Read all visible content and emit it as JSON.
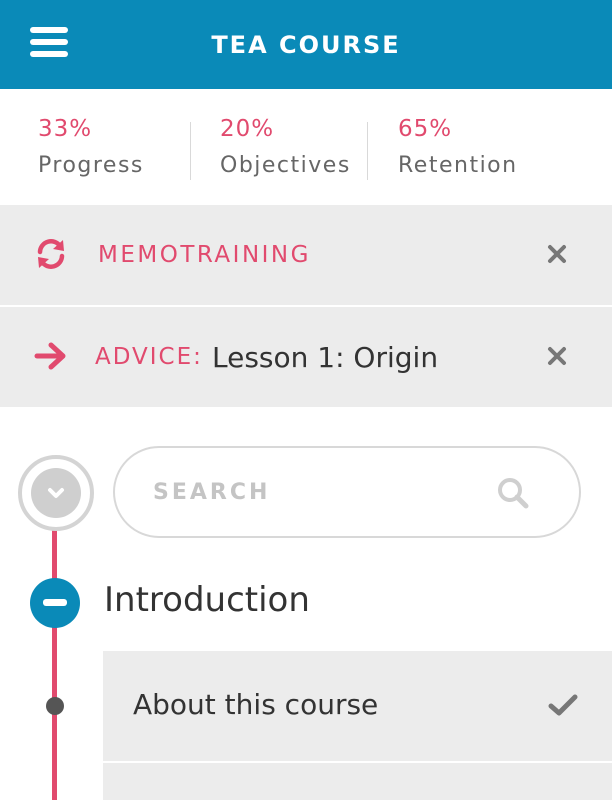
{
  "header": {
    "title": "TEA COURSE",
    "menu_icon": "hamburger-menu-icon",
    "background": "#0a8ab8"
  },
  "stats": [
    {
      "value": "33%",
      "label": "Progress"
    },
    {
      "value": "20%",
      "label": "Objectives"
    },
    {
      "value": "65%",
      "label": "Retention"
    }
  ],
  "memotraining": {
    "label": "MEMOTRAINING",
    "icon": "refresh-icon",
    "close_icon": "close-icon"
  },
  "advice": {
    "label": "ADVICE:",
    "lesson": "Lesson 1: Origin",
    "icon": "arrow-right-icon",
    "close_icon": "close-icon"
  },
  "search": {
    "placeholder": "SEARCH",
    "value": ""
  },
  "section": {
    "title": "Introduction"
  },
  "lessons": [
    {
      "title": "About this course",
      "completed": true
    }
  ],
  "colors": {
    "accent": "#e14a6e",
    "primary": "#0a8ab8",
    "panel": "#ececec"
  }
}
